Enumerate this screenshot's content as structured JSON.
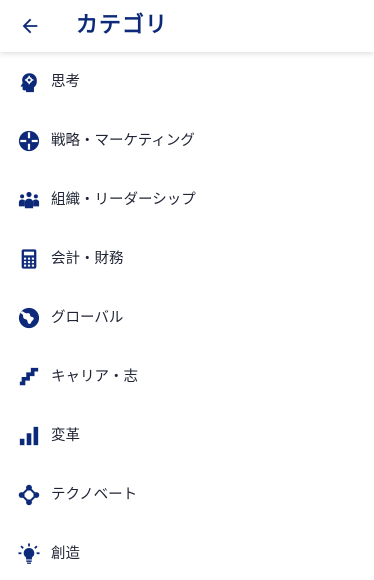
{
  "header": {
    "back_icon": "arrow-left-icon",
    "title": "カテゴリ"
  },
  "colors": {
    "accent": "#0d2a7a",
    "text": "#1f2333",
    "background": "#ffffff"
  },
  "categories": [
    {
      "label": "思考",
      "icon": "head-gear-icon"
    },
    {
      "label": "戦略・マーケティング",
      "icon": "crosshair-icon"
    },
    {
      "label": "組織・リーダーシップ",
      "icon": "people-group-icon"
    },
    {
      "label": "会計・財務",
      "icon": "calculator-icon"
    },
    {
      "label": "グローバル",
      "icon": "globe-icon"
    },
    {
      "label": "キャリア・志",
      "icon": "stairs-icon"
    },
    {
      "label": "変革",
      "icon": "bar-chart-icon"
    },
    {
      "label": "テクノベート",
      "icon": "network-diamond-icon"
    },
    {
      "label": "創造",
      "icon": "lightbulb-icon"
    }
  ]
}
